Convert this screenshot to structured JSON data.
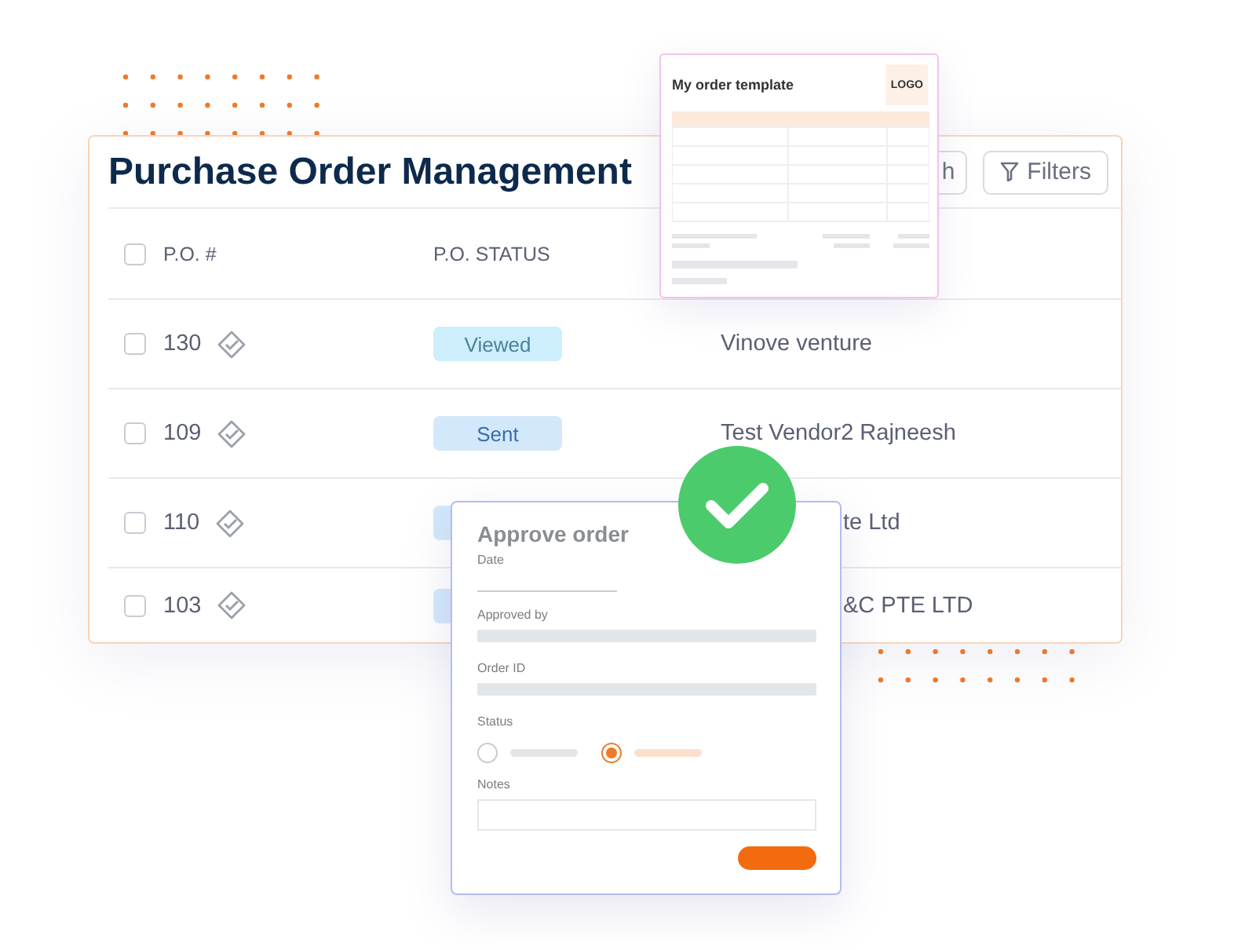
{
  "po_table": {
    "title": "Purchase Order Management",
    "search_button": "h",
    "filters_button": "Filters",
    "header": {
      "checked": false,
      "columns": [
        "P.O. #",
        "P.O. STATUS"
      ]
    },
    "rows": [
      {
        "checked": false,
        "number": "130",
        "status": "Viewed",
        "color": "#cdeefc",
        "vendor": "Vinove venture"
      },
      {
        "checked": false,
        "number": "109",
        "status": "Sent",
        "color": "#d3e8fb",
        "vendor": "Test Vendor2 Rajneesh"
      },
      {
        "checked": false,
        "number": "110",
        "color": "#d3e8fb",
        "vendor": "te Ltd"
      },
      {
        "checked": false,
        "number": "103",
        "color": "#d3e8fb",
        "vendor": "&C PTE LTD"
      }
    ]
  },
  "template_card": {
    "title": "My order template",
    "logo": "LOGO"
  },
  "approve_card": {
    "title": "Approve order",
    "date_label": "Date",
    "approved_by_label": "Approved by",
    "order_id_label": "Order ID",
    "status_label": "Status",
    "status_options": [
      {
        "selected": false
      },
      {
        "selected": true
      }
    ],
    "notes_label": "Notes"
  }
}
